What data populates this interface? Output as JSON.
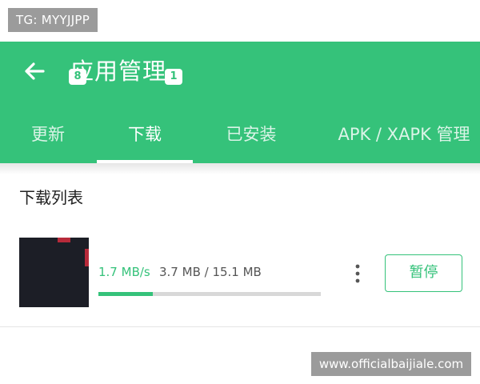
{
  "watermarks": {
    "top_left": "TG: MYYJJPP",
    "bottom_right": "www.officialbaijiale.com"
  },
  "header": {
    "back_icon": "arrow-left-icon",
    "title": "应用管理",
    "background_color": "#35c27a"
  },
  "tabs": [
    {
      "label": "更新",
      "badge": "8",
      "active": false
    },
    {
      "label": "下载",
      "badge": "1",
      "active": true
    },
    {
      "label": "已安装",
      "active": false
    },
    {
      "label": "APK / XAPK 管理",
      "active": false
    }
  ],
  "downloads": {
    "section_title": "下载列表",
    "items": [
      {
        "speed": "1.7 MB/s",
        "size": "3.7 MB / 15.1 MB",
        "progress": 0.245,
        "more_icon": "more-vertical-icon",
        "action_label": "暂停"
      }
    ]
  }
}
